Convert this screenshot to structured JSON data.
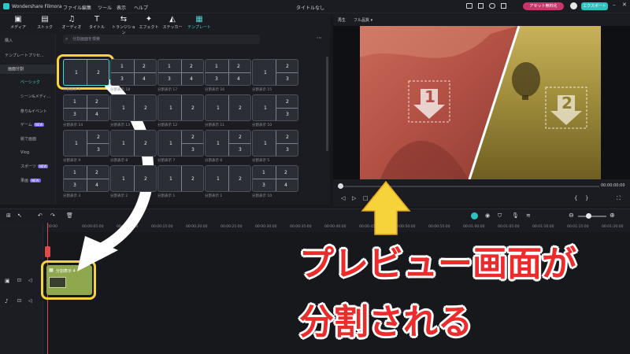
{
  "app": {
    "name": "Wondershare Filmora",
    "window_title": "タイトルなし"
  },
  "menu": [
    "ファイル",
    "編集",
    "ツール",
    "表示",
    "ヘルプ"
  ],
  "titlebar_right": {
    "upgrade": "アセット無料化",
    "export": "エクスポート"
  },
  "toolbar": [
    {
      "label": "メディア",
      "icon": "media-icon"
    },
    {
      "label": "ストック",
      "icon": "stock-icon"
    },
    {
      "label": "オーディオ",
      "icon": "audio-icon"
    },
    {
      "label": "タイトル",
      "icon": "title-icon"
    },
    {
      "label": "トランジション",
      "icon": "transition-icon"
    },
    {
      "label": "エフェクト",
      "icon": "effect-icon"
    },
    {
      "label": "ステッカー",
      "icon": "sticker-icon"
    },
    {
      "label": "テンプレート",
      "icon": "template-icon",
      "active": true
    }
  ],
  "sidebar": {
    "items": [
      {
        "label": "購入"
      },
      {
        "label": "テンプレートプリセ..."
      },
      {
        "label": "画面分割",
        "category": true
      },
      {
        "label": "ベーシック",
        "selected": true
      },
      {
        "label": "シーン&メディ..."
      },
      {
        "label": "祭り&イベント"
      },
      {
        "label": "ゲーム",
        "badge": "NEW"
      },
      {
        "label": "絵で画面"
      },
      {
        "label": "Vlog"
      },
      {
        "label": "スポーツ",
        "badge": "NEW"
      },
      {
        "label": "果画",
        "badge": "NEW"
      }
    ]
  },
  "search": {
    "placeholder": "分割画面を検索"
  },
  "templates": [
    {
      "caption": "分割表示 4",
      "nums": [
        "1",
        "2"
      ]
    },
    {
      "caption": "分割表示 18",
      "nums": [
        "1",
        "2",
        "3",
        "4"
      ]
    },
    {
      "caption": "分割表示 17",
      "nums": [
        "1",
        "2",
        "3",
        "4"
      ]
    },
    {
      "caption": "分割表示 16",
      "nums": [
        "1",
        "2",
        "3",
        "4"
      ]
    },
    {
      "caption": "分割表示 15",
      "nums": [
        "1",
        "2",
        "3"
      ]
    },
    {
      "caption": "分割表示 14",
      "nums": [
        "1",
        "2",
        "3",
        "4"
      ]
    },
    {
      "caption": "分割表示 13",
      "nums": [
        "1",
        "2"
      ]
    },
    {
      "caption": "分割表示 12",
      "nums": [
        "1",
        "2"
      ]
    },
    {
      "caption": "分割表示 11",
      "nums": [
        "1",
        "2"
      ]
    },
    {
      "caption": "分割表示 10",
      "nums": [
        "1",
        "2",
        "3"
      ]
    },
    {
      "caption": "分割表示 9",
      "nums": [
        "1",
        "2",
        "3"
      ]
    },
    {
      "caption": "分割表示 8",
      "nums": [
        "1",
        "2"
      ]
    },
    {
      "caption": "分割表示 7",
      "nums": [
        "1",
        "2",
        "3"
      ]
    },
    {
      "caption": "分割表示 6",
      "nums": [
        "1",
        "2",
        "3"
      ]
    },
    {
      "caption": "分割表示 5",
      "nums": [
        "1",
        "2",
        "3"
      ]
    },
    {
      "caption": "分割表示 3",
      "nums": [
        "1",
        "2",
        "3",
        "4"
      ]
    },
    {
      "caption": "分割表示 2",
      "nums": [
        "1",
        "2"
      ]
    },
    {
      "caption": "分割表示 1",
      "nums": [
        "1",
        "2"
      ]
    },
    {
      "caption": "分割表示 1",
      "nums": [
        "1",
        "2"
      ]
    },
    {
      "caption": "分割表示 10",
      "nums": [
        "1",
        "2",
        "3",
        "4"
      ]
    }
  ],
  "preview": {
    "tab_player": "再生",
    "quality": "フル品質",
    "time": "00:00:00:00",
    "panel_1": "1",
    "panel_2": "2"
  },
  "ruler": [
    "00:00",
    "00:00:05:00",
    "00:00:10:00",
    "00:00:15:00",
    "00:00:20:00",
    "00:00:25:00",
    "00:00:30:00",
    "00:00:35:00",
    "00:00:40:00",
    "00:00:45:00",
    "00:00:50:00",
    "00:00:55:00",
    "00:01:00:00",
    "00:01:05:00",
    "00:01:10:00",
    "00:01:15:00",
    "00:01:20:00"
  ],
  "clip": {
    "label": "分割表示 4"
  },
  "annotation": {
    "line1": "プレビュー画面が",
    "line2": "分割される"
  },
  "colors": {
    "accent": "#4ad5d5",
    "highlight": "#f7d33b",
    "annotation_text": "#ec2b2b",
    "clip": "#8fa84e"
  }
}
